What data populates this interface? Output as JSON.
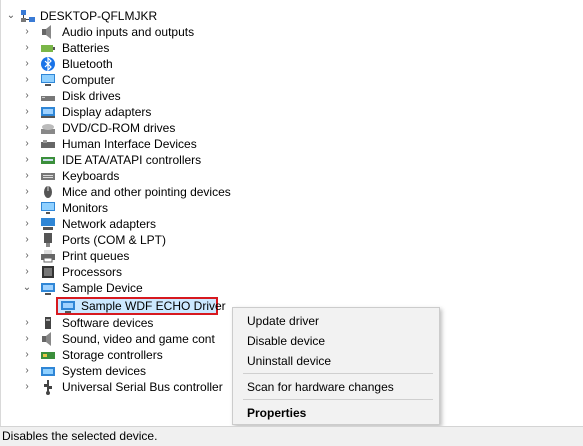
{
  "computer_name": "DESKTOP-QFLMJKR",
  "tree_items": [
    {
      "label": "Audio inputs and outputs",
      "icon": "speaker-icon"
    },
    {
      "label": "Batteries",
      "icon": "battery-icon"
    },
    {
      "label": "Bluetooth",
      "icon": "bluetooth-icon"
    },
    {
      "label": "Computer",
      "icon": "computer-icon"
    },
    {
      "label": "Disk drives",
      "icon": "disk-drive-icon"
    },
    {
      "label": "Display adapters",
      "icon": "display-adapter-icon"
    },
    {
      "label": "DVD/CD-ROM drives",
      "icon": "dvd-icon"
    },
    {
      "label": "Human Interface Devices",
      "icon": "hid-icon"
    },
    {
      "label": "IDE ATA/ATAPI controllers",
      "icon": "ide-icon"
    },
    {
      "label": "Keyboards",
      "icon": "keyboard-icon"
    },
    {
      "label": "Mice and other pointing devices",
      "icon": "mouse-icon"
    },
    {
      "label": "Monitors",
      "icon": "monitor-icon"
    },
    {
      "label": "Network adapters",
      "icon": "network-icon"
    },
    {
      "label": "Ports (COM & LPT)",
      "icon": "port-icon"
    },
    {
      "label": "Print queues",
      "icon": "printer-icon"
    },
    {
      "label": "Processors",
      "icon": "processor-icon"
    },
    {
      "label": "Sample Device",
      "icon": "device-icon"
    }
  ],
  "child_item": "Sample WDF ECHO Driver",
  "tree_items_after": [
    {
      "label": "Software devices",
      "icon": "software-icon"
    },
    {
      "label": "Sound, video and game cont",
      "icon": "sound-icon"
    },
    {
      "label": "Storage controllers",
      "icon": "storage-icon"
    },
    {
      "label": "System devices",
      "icon": "system-icon"
    },
    {
      "label": "Universal Serial Bus controller",
      "icon": "usb-icon"
    }
  ],
  "context_menu": {
    "update": "Update driver",
    "disable": "Disable device",
    "uninstall": "Uninstall device",
    "scan": "Scan for hardware changes",
    "properties": "Properties"
  },
  "status_text": "Disables the selected device.",
  "colors": {
    "selection": "#cce8ff",
    "highlight_border": "#d7191f",
    "menu_bg": "#f2f2f2"
  }
}
